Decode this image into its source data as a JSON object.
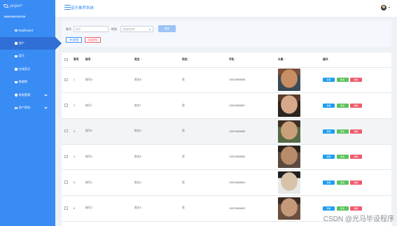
{
  "brand": {
    "logo_text": "paper"
  },
  "sidebar": {
    "nav_title": "MAIN NAVIGATION",
    "items": [
      {
        "label": "Dashboard",
        "icon": "circle-icon"
      },
      {
        "label": "用户",
        "icon": "grid-icon",
        "active": true
      },
      {
        "label": "音乐",
        "icon": "grid-icon"
      },
      {
        "label": "在线音乐",
        "icon": "grid-icon"
      },
      {
        "label": "热搜榜",
        "icon": "grid-icon"
      },
      {
        "label": "系统管理",
        "icon": "location-pin-icon",
        "expandable": true
      },
      {
        "label": "用户资料",
        "icon": "id-card-icon",
        "expandable": true
      }
    ]
  },
  "header": {
    "title": "音乐推荐系统"
  },
  "search": {
    "account_label": "账号",
    "account_placeholder": "账号",
    "gender_label": "性别",
    "gender_placeholder": "请选择性别",
    "search_button": "搜索",
    "add_button": "添加数据",
    "batch_delete_button": "批量删除"
  },
  "table": {
    "headers": [
      "索号",
      "账号",
      "姓名",
      "性别",
      "手机",
      "头像",
      "操作"
    ],
    "rows": [
      {
        "index": "1",
        "account": "账号8",
        "name": "姓名8",
        "gender": "男",
        "phone": "13823888888",
        "photo_colors": [
          "#3b4a55",
          "#c98e63",
          "#7a4e3a"
        ]
      },
      {
        "index": "2",
        "account": "账号7",
        "name": "姓名7",
        "gender": "男",
        "phone": "13823888887",
        "photo_colors": [
          "#2c2420",
          "#d7a98a",
          "#5a3b2c"
        ]
      },
      {
        "index": "3",
        "account": "账号6",
        "name": "姓名6",
        "gender": "男",
        "phone": "13823888886",
        "photo_colors": [
          "#556b44",
          "#caa07a",
          "#3e2f25"
        ]
      },
      {
        "index": "4",
        "account": "账号5",
        "name": "姓名5",
        "gender": "男",
        "phone": "13823888885",
        "photo_colors": [
          "#5b4a3f",
          "#b88c6b",
          "#2b221d"
        ]
      },
      {
        "index": "5",
        "account": "账号4",
        "name": "姓名4",
        "gender": "男",
        "phone": "13823888884",
        "photo_colors": [
          "#e9e9e9",
          "#d8c2aa",
          "#1f1f1f"
        ]
      },
      {
        "index": "6",
        "account": "账号3",
        "name": "姓名3",
        "gender": "男",
        "phone": "13823888883",
        "photo_colors": [
          "#6a4f3e",
          "#c49a7b",
          "#3a2a22"
        ]
      }
    ],
    "actions": {
      "view": "查看",
      "edit": "修改",
      "delete": "删除"
    }
  },
  "watermark": "CSDN @光马毕设程序",
  "colors": {
    "primary": "#3a8cf5",
    "view": "#1f9ef0",
    "edit": "#5cc25c",
    "delete": "#f05a6e"
  }
}
